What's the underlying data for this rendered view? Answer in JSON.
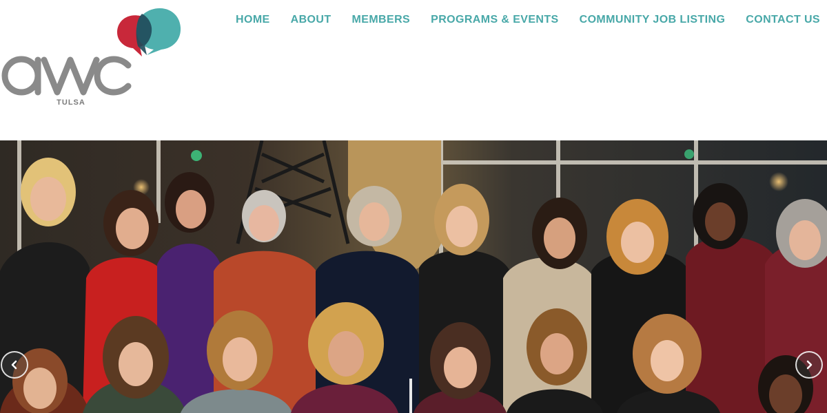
{
  "logo": {
    "wordmark": "awc",
    "tagline": "TULSA",
    "colors": {
      "wordmark": "#8a8a8a",
      "bubble_red": "#c8283a",
      "bubble_teal": "#4fb0ae",
      "bubble_overlap": "#1f4a5a"
    }
  },
  "nav": {
    "items": [
      {
        "label": "HOME"
      },
      {
        "label": "ABOUT"
      },
      {
        "label": "MEMBERS"
      },
      {
        "label": "PROGRAMS & EVENTS"
      },
      {
        "label": "COMMUNITY JOB LISTING"
      },
      {
        "label": "CONTACT US"
      }
    ],
    "color": "#48a8a8"
  },
  "hero": {
    "image_icon": "group-photo",
    "prev_icon": "chevron-left-icon",
    "next_icon": "chevron-right-icon"
  }
}
